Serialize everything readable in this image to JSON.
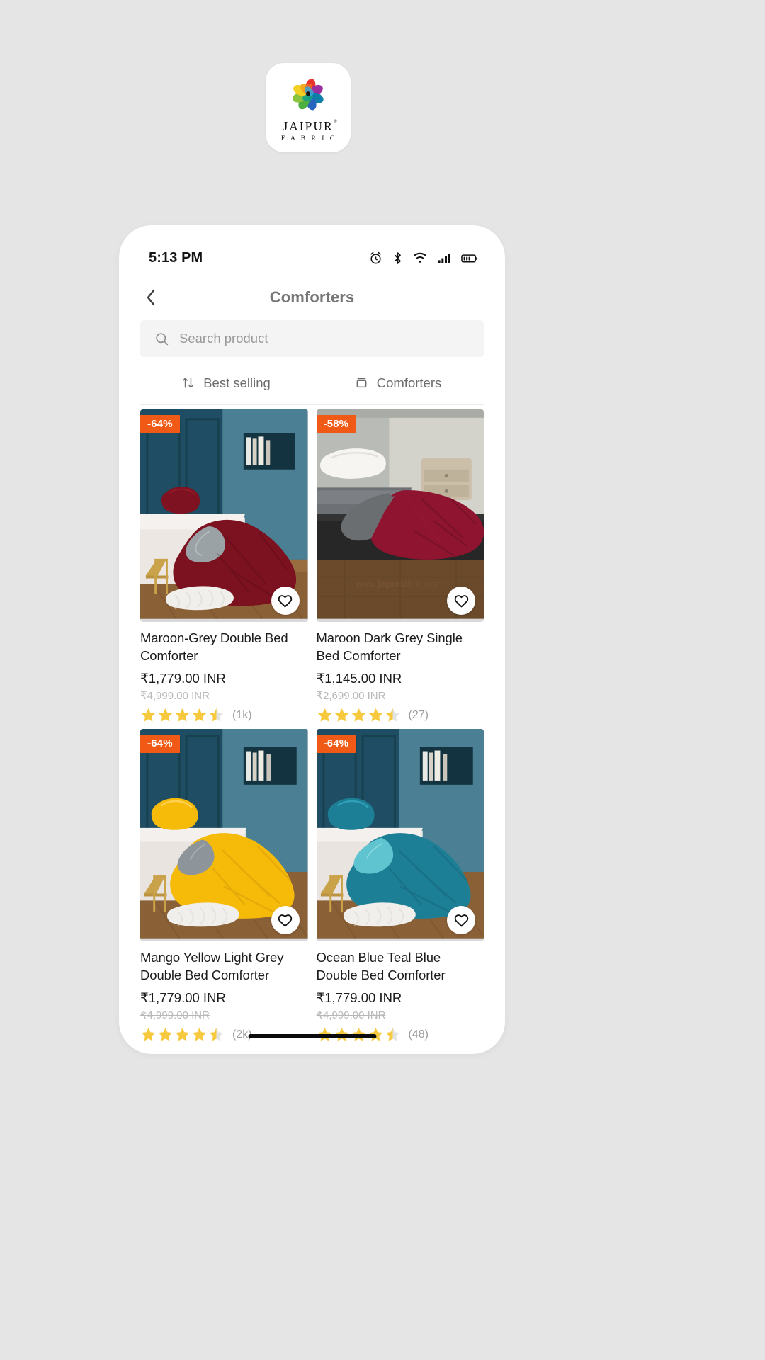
{
  "brand": {
    "name": "JAIPUR",
    "registered": "®",
    "subtitle": "F A B R I C",
    "logo_icon": "pinwheel-flower-logo",
    "petal_colors": [
      "#e8342a",
      "#9c2fa0",
      "#b4238f",
      "#1b78c2",
      "#2e9fd6",
      "#16a085",
      "#4caf3f",
      "#8bc53f",
      "#f2d024",
      "#f4a41c",
      "#f06522"
    ]
  },
  "status_bar": {
    "time": "5:13 PM",
    "icons": [
      "alarm-icon",
      "bluetooth-icon",
      "wifi-icon",
      "cellular-signal-icon",
      "battery-icon"
    ]
  },
  "app_bar": {
    "back_icon": "chevron-left-icon",
    "title": "Comforters"
  },
  "search": {
    "icon": "search-icon",
    "placeholder": "Search product",
    "value": ""
  },
  "filter_bar": {
    "sort": {
      "icon": "sort-arrows-icon",
      "label": "Best selling"
    },
    "filter": {
      "icon": "filter-box-icon",
      "label": "Comforters"
    }
  },
  "products": [
    {
      "badge": "-64%",
      "title": "Maroon-Grey  Double Bed Comforter",
      "price": "₹1,779.00 INR",
      "compare_at": "₹4,999.00 INR",
      "rating": 4.5,
      "rating_count": "(1k)",
      "wishlist_icon": "heart-icon",
      "image": {
        "scene": "maroon-grey-comforter-on-bed",
        "wall": "#2b5a70",
        "comforter": "#7e1220",
        "accent": "#9aa2a6"
      }
    },
    {
      "badge": "-58%",
      "title": "Maroon Dark Grey Single Bed Comforter",
      "price": "₹1,145.00 INR",
      "compare_at": "₹2,699.00 INR",
      "rating": 4.5,
      "rating_count": "(27)",
      "wishlist_icon": "heart-icon",
      "image": {
        "scene": "maroon-dark-grey-single-bed",
        "wall": "#c7c9c4",
        "comforter": "#8e1430",
        "accent": "#6a6e71"
      }
    },
    {
      "badge": "-64%",
      "title": "Mango Yellow Light Grey Double Bed Comforter",
      "price": "₹1,779.00 INR",
      "compare_at": "₹4,999.00 INR",
      "rating": 4.5,
      "rating_count": "(2k)",
      "wishlist_icon": "heart-icon",
      "image": {
        "scene": "mango-yellow-comforter-on-bed",
        "wall": "#2b5a70",
        "comforter": "#f6ba09",
        "accent": "#8d959a"
      }
    },
    {
      "badge": "-64%",
      "title": "Ocean Blue Teal Blue Double Bed Comforter",
      "price": "₹1,779.00 INR",
      "compare_at": "₹4,999.00 INR",
      "rating": 4.5,
      "rating_count": "(48)",
      "wishlist_icon": "heart-icon",
      "image": {
        "scene": "ocean-blue-teal-comforter-on-bed",
        "wall": "#2b5a70",
        "comforter": "#1d7f95",
        "accent": "#5fc4cf"
      }
    }
  ],
  "colors": {
    "page_background": "#e5e5e5",
    "badge_orange": "#f05a16",
    "star_gold": "#f7c93e",
    "star_empty": "#e3e3e3",
    "title_gray": "#767676"
  },
  "home_indicator": "home-indicator-bar"
}
